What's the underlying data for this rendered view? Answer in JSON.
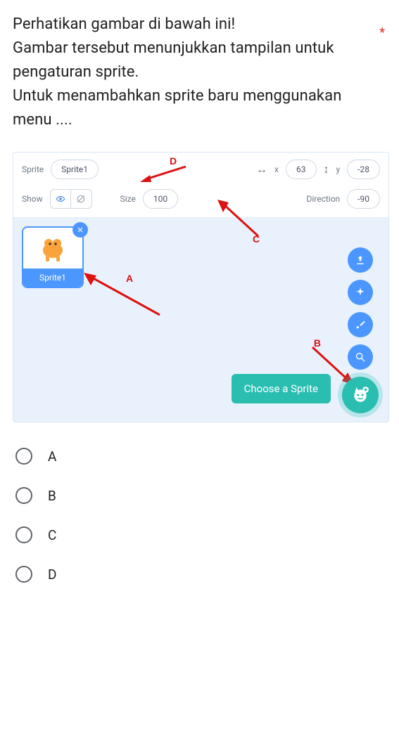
{
  "question": {
    "required_mark": "*",
    "text_line1": "Perhatikan gambar di bawah ini!",
    "text_line2": "Gambar tersebut menunjukkan tampilan untuk pengaturan sprite.",
    "text_line3": "Untuk menambahkan sprite baru menggunakan menu ...."
  },
  "sprite_panel": {
    "sprite_label": "Sprite",
    "sprite_name": "Sprite1",
    "x_label": "x",
    "x_value": "63",
    "y_label": "y",
    "y_value": "-28",
    "show_label": "Show",
    "size_label": "Size",
    "size_value": "100",
    "direction_label": "Direction",
    "direction_value": "-90",
    "tile_name": "Sprite1",
    "tooltip": "Choose a Sprite"
  },
  "markers": {
    "a": "A",
    "b": "B",
    "c": "C",
    "d": "D"
  },
  "options": [
    "A",
    "B",
    "C",
    "D"
  ]
}
